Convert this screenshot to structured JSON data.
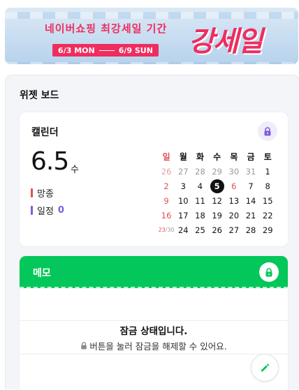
{
  "banner": {
    "headline": "네이버쇼핑 최강세일 기간",
    "date_start": "6/3 MON",
    "date_end": "6/9 SUN",
    "big_title": "강세일",
    "accent": "#ef2d5e"
  },
  "board": {
    "title": "위젯 보드"
  },
  "calendar": {
    "title": "캘린더",
    "lock_icon": "lock-icon",
    "today_date": "6.5",
    "today_dow": "수",
    "legend": [
      {
        "label": "망종",
        "color": "#e24f4f",
        "count": ""
      },
      {
        "label": "일정",
        "color": "#7c5ce0",
        "count": "0"
      }
    ],
    "weekdays": [
      "일",
      "월",
      "화",
      "수",
      "목",
      "금",
      "토"
    ],
    "weeks": [
      [
        "26",
        "27",
        "28",
        "29",
        "30",
        "31",
        "1"
      ],
      [
        "2",
        "3",
        "4",
        "5",
        "6",
        "7",
        "8"
      ],
      [
        "9",
        "10",
        "11",
        "12",
        "13",
        "14",
        "15"
      ],
      [
        "16",
        "17",
        "18",
        "19",
        "20",
        "21",
        "22"
      ],
      [
        "23/30",
        "24",
        "25",
        "26",
        "27",
        "28",
        "29"
      ]
    ],
    "today": "5"
  },
  "memo": {
    "title": "메모",
    "lock_icon": "lock-icon",
    "locked_title": "잠금 상태입니다.",
    "locked_desc": "버튼을 눌러 잠금을 해제할 수 있어요.",
    "edit_icon": "pencil-icon",
    "accent": "#03c75a"
  }
}
